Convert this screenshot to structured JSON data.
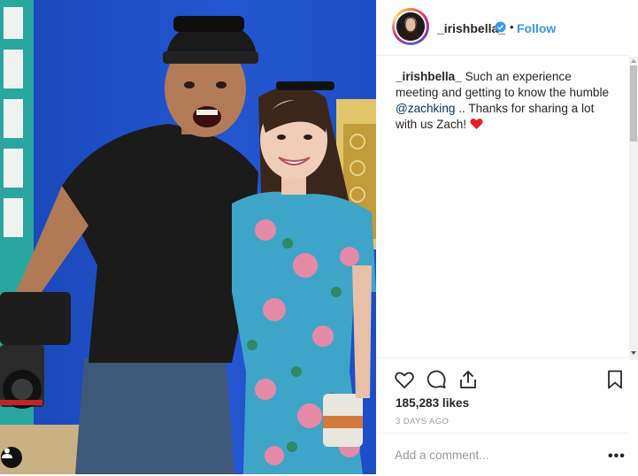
{
  "post": {
    "username": "_irishbella_",
    "follow_label": "Follow",
    "separator": "•",
    "caption": {
      "username": "_irishbella_",
      "text_before": " Such an experience meeting and getting to know the humble ",
      "mention": "@zachking",
      "text_after": " .. Thanks for sharing a lot with us Zach! "
    },
    "likes": "185,283 likes",
    "timestamp": "3 DAYS AGO",
    "comment_placeholder": "Add a comment...",
    "more_label": "•••"
  },
  "icons": {
    "verified": "verified-badge-icon",
    "like": "heart-outline-icon",
    "comment": "speech-bubble-icon",
    "share": "share-upload-icon",
    "save": "bookmark-icon",
    "tag": "user-tag-icon",
    "caption_emoji": "red-heart-emoji"
  },
  "colors": {
    "link_blue": "#3897f0",
    "mention": "#003569",
    "heart": "#ed1c24",
    "wall_blue": "#1e4fc4",
    "muted_text": "#999999",
    "divider": "#efefef"
  }
}
